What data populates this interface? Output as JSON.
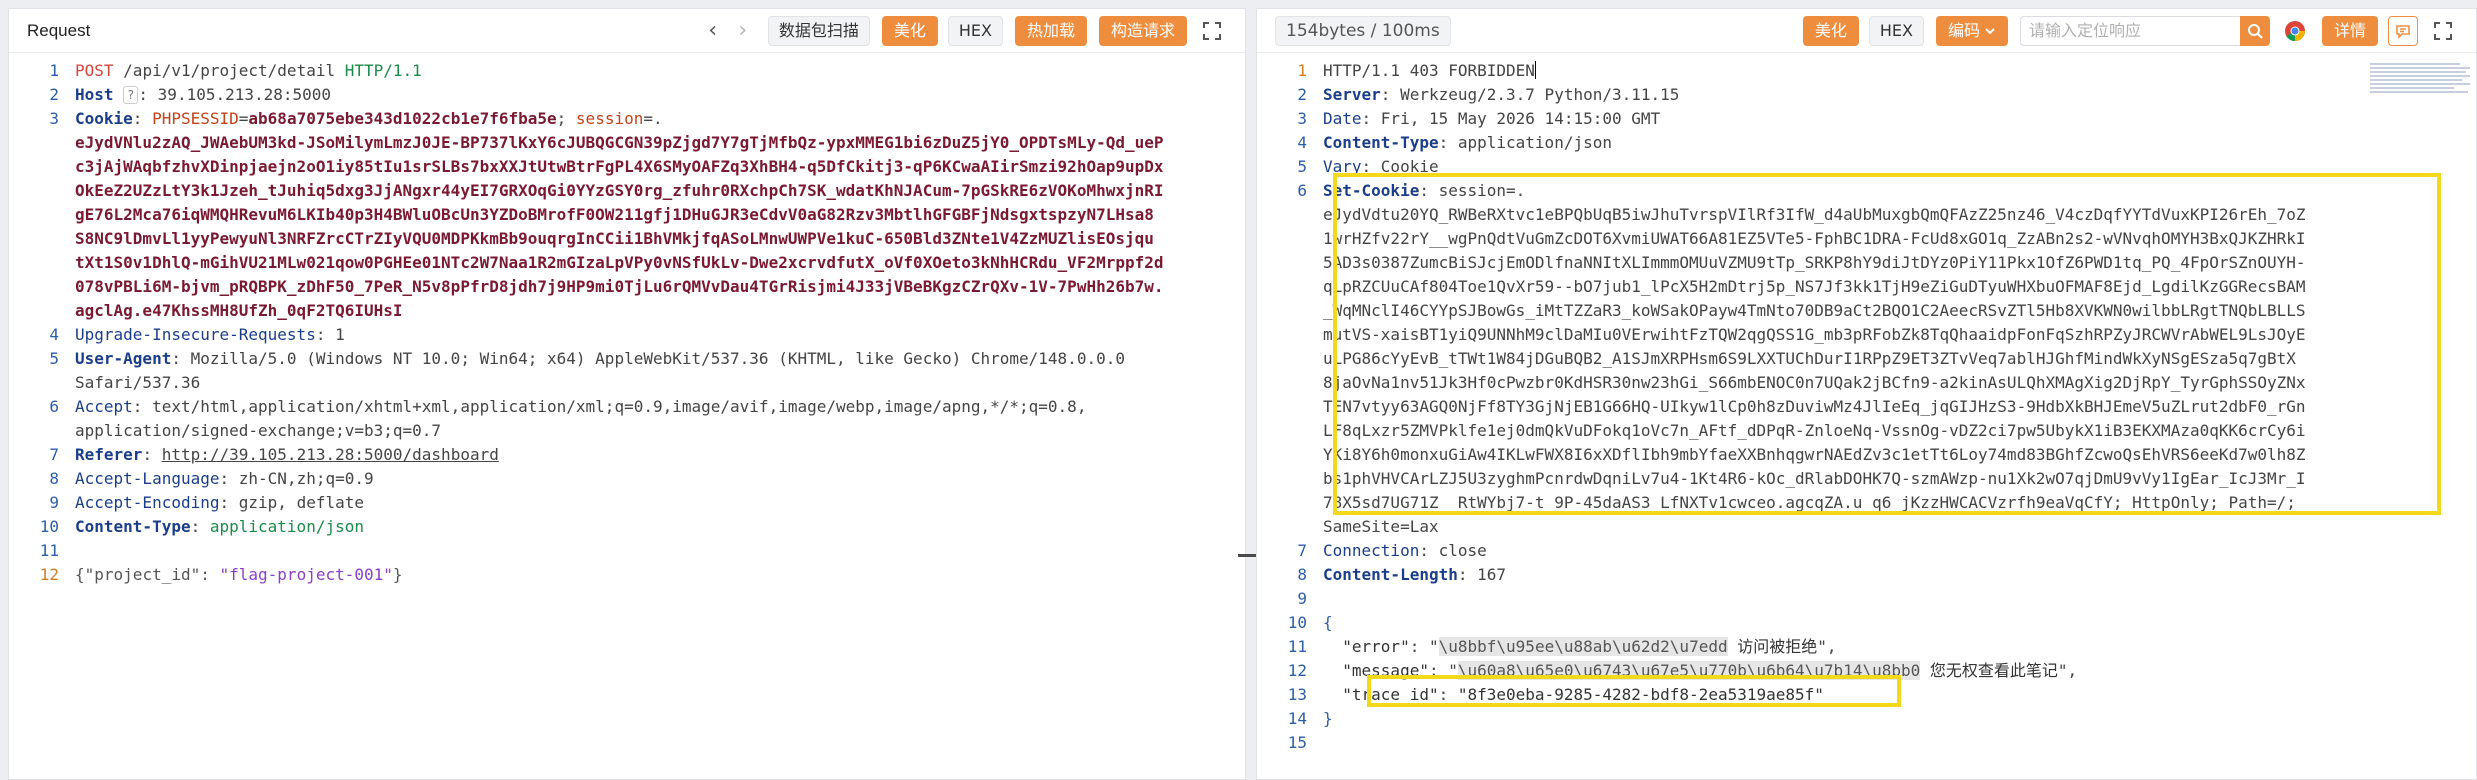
{
  "request": {
    "title": "Request",
    "nav_back": "‹",
    "nav_forward": "›",
    "buttons": {
      "scan": "数据包扫描",
      "beautify": "美化",
      "hex": "HEX",
      "hot_load": "热加载",
      "build_request": "构造请求"
    },
    "lines": [
      {
        "n": "1"
      },
      {
        "n": "2"
      },
      {
        "n": "3"
      },
      {
        "n": "4"
      },
      {
        "n": "5"
      },
      {
        "n": "6"
      },
      {
        "n": "7"
      },
      {
        "n": "8"
      },
      {
        "n": "9"
      },
      {
        "n": "10"
      },
      {
        "n": "11"
      },
      {
        "n": "12"
      }
    ],
    "method": "POST",
    "path": "/api/v1/project/detail",
    "http_version": "HTTP/1.1",
    "host_key": "Host",
    "host_badge": "?",
    "host_value": "39.105.213.28:5000",
    "cookie_key": "Cookie",
    "phpsessid_key": "PHPSESSID",
    "phpsessid_value": "ab68a7075ebe343d1022cb1e7f6fba5e",
    "session_key": "session",
    "session_value_lines": [
      "eJydVNlu2zAQ_JWAebUM3kd-JSoMilymLmzJ0JE-BP737lKxY6cJUBQGCGN39pZjgd7Y7gTjMfbQz-ypxMMEG1bi6zDuZ5jY0_OPDTsMLy-Qd_ueP",
      "c3jAjWAqbfzhvXDinpjaejn2oO1iy85tIu1srSLBs7bxXXJtUtwBtrFgPL4X6SMyOAFZq3XhBH4-q5DfCkitj3-qP6KCwaAIirSmzi92hOap9upDx",
      "OkEeZ2UZzLtY3k1Jzeh_tJuhiq5dxg3JjANgxr44yEI7GRXOqGi0YYzGSY0rg_zfuhr0RXchpCh7SK_wdatKhNJACum-7pGSkRE6zVOKoMhwxjnRI",
      "gE76L2Mca76iqWMQHRevuM6LKIb40p3H4BWluOBcUn3YZDoBMrofF0OW211gfj1DHuGJR3eCdvV0aG82Rzv3MbtlhGFGBFjNdsgxtspzyN7LHsa8",
      "S8NC9lDmvLl1yyPewyuNl3NRFZrcCTrZIyVQU0MDPKkmBb9ouqrgInCCii1BhVMkjfqASoLMnwUWPVe1kuC-650Bld3ZNte1V4ZzMUZlisEOsjqu",
      "tXt1S0v1DhlQ-mGihVU21MLw021qow0PGHEe01NTc2W7Naa1R2mGIzaLpVPy0vNSfUkLv-Dwe2xcrvdfutX_oVf0XOeto3kNhHCRdu_VF2Mrppf2d",
      "078vPBLi6M-bjvm_pRQBPK_zDhF50_7PeR_N5v8pPfrD8jdh7j9HP9mi0TjLu6rQMVvDau4TGrRisjmi4J33jVBeBKgzCZrQXv-1V-7PwHh26b7w.",
      "agclAg.e47KhssMH8UfZh_0qF2TQ6IUHsI"
    ],
    "upgrade_key": "Upgrade-Insecure-Requests",
    "upgrade_value": "1",
    "ua_key": "User-Agent",
    "ua_value_1": "Mozilla/5.0 (Windows NT 10.0; Win64; x64) AppleWebKit/537.36 (KHTML, like Gecko) Chrome/148.0.0.0",
    "ua_value_2": "Safari/537.36",
    "accept_key": "Accept",
    "accept_value_1": "text/html,application/xhtml+xml,application/xml;q=0.9,image/avif,image/webp,image/apng,*/*;q=0.8,",
    "accept_value_2": "application/signed-exchange;v=b3;q=0.7",
    "referer_key": "Referer",
    "referer_value": "http://39.105.213.28:5000/dashboard",
    "al_key": "Accept-Language",
    "al_value": "zh-CN,zh;q=0.9",
    "ae_key": "Accept-Encoding",
    "ae_value": "gzip, deflate",
    "ct_key": "Content-Type",
    "ct_value": "application/json",
    "body_key": "\"project_id\"",
    "body_value": "\"flag-project-001\""
  },
  "response": {
    "stats": "154bytes / 100ms",
    "buttons": {
      "beautify": "美化",
      "hex": "HEX",
      "encoding": "编码",
      "details": "详情"
    },
    "search_placeholder": "请输入定位响应",
    "lines": [
      {
        "n": "1"
      },
      {
        "n": "2"
      },
      {
        "n": "3"
      },
      {
        "n": "4"
      },
      {
        "n": "5"
      },
      {
        "n": "6"
      },
      {
        "n": "7"
      },
      {
        "n": "8"
      },
      {
        "n": "9"
      },
      {
        "n": "10"
      },
      {
        "n": "11"
      },
      {
        "n": "12"
      },
      {
        "n": "13"
      },
      {
        "n": "14"
      },
      {
        "n": "15"
      }
    ],
    "status_line": "HTTP/1.1 403 FORBIDDEN",
    "server_key": "Server",
    "server_value": "Werkzeug/2.3.7 Python/3.11.15",
    "date_key": "Date",
    "date_value": "Fri, 15 May 2026 14:15:00 GMT",
    "ct_key": "Content-Type",
    "ct_value": "application/json",
    "vary_key": "Vary",
    "vary_value": "Cookie",
    "setcookie_key": "Set-Cookie",
    "setcookie_prefix": "session=.",
    "setcookie_lines": [
      "eJydVdtu20YQ_RWBeRXtvc1eBPQbUqB5iwJhuTvrspVIlRf3IfW_d4aUbMuxgbQmQFAzZ25nz46_V4czDqfYYTdVuxKPI26rEh_7oZ",
      "1wrHZfv22rY__wgPnQdtVuGmZcDOT6XvmiUWAT66A81EZ5VTe5-FphBC1DRA-FcUd8xGO1q_ZzABn2s2-wVNvqhOMYH3BxQJKZHRkI",
      "5AD3s0387ZumcBiSJcjEmODlfnaNNItXLImmmOMUuVZMU9tTp_SRKP8hY9diJtDYz0PiY11Pkx1OfZ6PWD1tq_PQ_4FpOrSZnOUYH-",
      "qLpRZCUuCAf804Toe1QvXr59--bO7jub1_lPcX5H2mDtrj5p_NS7Jf3kk1TjH9eZiGuDTyuWHXbuOFMAF8Ejd_LgdilKzGGRecsBAM",
      "_WqMNclI46CYYpSJBowGs_iMtTZZaR3_koWSakOPayw4TmNto70DB9aCt2BQO1C2AeecRSvZTl5Hb8XVKWN0wilbbLRgtTNQbLBLLS",
      "mutVS-xaisBT1yiQ9UNNhM9clDaMIu0VErwihtFzTQW2qgQSS1G_mb3pRFobZk8TqQhaaidpFonFqSzhRPZyJRCWVrAbWEL9LsJOyE",
      "uLPG86cYyEvB_tTWt1W84jDGuBQB2_A1SJmXRPHsm6S9LXXTUChDurI1RPpZ9ET3ZTvVeq7ablHJGhfMindWkXyNSgESza5q7gBtX",
      "8jaOvNa1nv51Jk3Hf0cPwzbr0KdHSR30nw23hGi_S66mbENOC0n7UQak2jBCfn9-a2kinAsULQhXMAgXig2DjRpY_TyrGphSSOyZNx",
      "TEN7vtyy63AGQ0NjFf8TY3GjNjEB1G66HQ-UIkyw1lCp0h8zDuviwMz4JlIeEq_jqGIJHzS3-9HdbXkBHJEmeV5uZLrut2dbF0_rGn",
      "LF8qLxzr5ZMVPklfe1ej0dmQkVuDFokq1oVc7n_AFtf_dDPqR-ZnloeNq-VssnOg-vDZ2ci7pw5UbykX1iB3EKXMAza0qKK6crCy6i",
      "YKi8Y6h0monxuGiAw4IKLwFWX8I6xXDflIbh9mbYfaeXXBnhqgwrNAEdZv3c1etTt6Loy74md83BGhfZcwoQsEhVRS6eeKd7w0lh8Z",
      "bs1phVHVCArLZJ5U3zyghmPcnrdwDqniLv7u4-1Kt4R6-kOc_dRlabDOHK7Q-szmAWzp-nu1Xk2wO7qjDmU9vVy1IgEar_IcJ3Mr_I",
      "78X5sd7UG71Z__RtWYbj7-t_9P-45daAS3_LfNXTv1cwceo.agcqZA.u_q6_jKzzHWCACVzrfh9eaVqCfY; HttpOnly; Path=/;"
    ],
    "setcookie_tail": "SameSite=Lax",
    "conn_key": "Connection",
    "conn_value": "close",
    "cl_key": "Content-Length",
    "cl_value": "167",
    "brace_open": "{",
    "brace_close": "}",
    "error_key": "\"error\"",
    "error_escape": "\\u8bbf\\u95ee\\u88ab\\u62d2\\u7edd",
    "error_cjk": "访问被拒绝",
    "message_key": "\"message\"",
    "message_escape": "\\u60a8\\u65e0\\u6743\\u67e5\\u770b\\u6b64\\u7b14\\u8bb0",
    "message_cjk": "您无权查看此笔记",
    "trace_key": "\"trace_id\"",
    "trace_value": "\"8f3e0eba-9285-4282-bdf8-2ea5319ae85f\""
  },
  "colors": {
    "accent": "#ef8d3f",
    "highlight": "#f4d81a",
    "line_number": "#2c5ea8",
    "header_key": "#1b3e8a"
  }
}
